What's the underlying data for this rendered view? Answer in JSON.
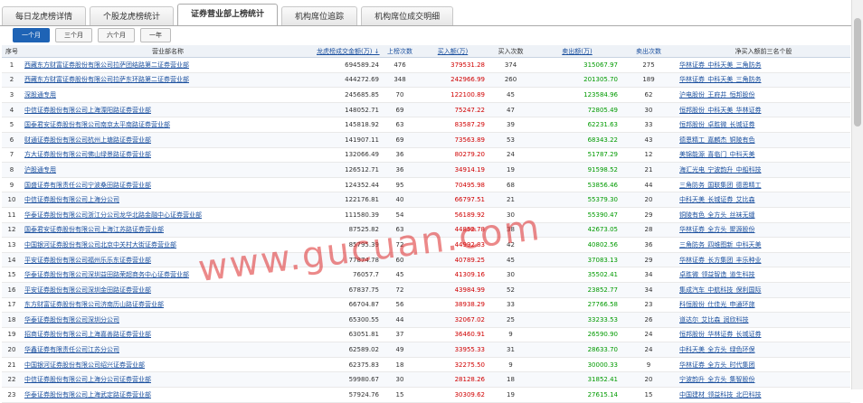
{
  "tabs": [
    {
      "label": "每日龙虎榜详情",
      "active": false
    },
    {
      "label": "个股龙虎榜统计",
      "active": false
    },
    {
      "label": "证券营业部上榜统计",
      "active": true
    },
    {
      "label": "机构席位追踪",
      "active": false
    },
    {
      "label": "机构席位成交明细",
      "active": false
    }
  ],
  "periods": [
    {
      "label": "一个月",
      "active": true
    },
    {
      "label": "三个月",
      "active": false
    },
    {
      "label": "六个月",
      "active": false
    },
    {
      "label": "一年",
      "active": false
    }
  ],
  "table": {
    "headers": [
      "序号",
      "营业部名称",
      "龙虎榜成交金额(万) ↓",
      "上榜次数",
      "买入额(万)",
      "买入次数",
      "卖出额(万)",
      "卖出次数",
      "净买入额前三名个股"
    ],
    "rows": [
      [
        "1",
        "西藏东方财富证券股份有限公司拉萨团结路第二证券营业部",
        "694589.24",
        "476",
        "379531.28",
        "374",
        "315067.97",
        "275",
        "华林证券 中科天美 三角防务"
      ],
      [
        "2",
        "西藏东方财富证券股份有限公司拉萨东环路第二证券营业部",
        "444272.69",
        "348",
        "242966.99",
        "260",
        "201305.70",
        "189",
        "华林证券 中科天美 三角防务"
      ],
      [
        "3",
        "深股通专用",
        "245685.85",
        "70",
        "122100.89",
        "45",
        "123584.96",
        "62",
        "沪电股份 王府井 恒邦股份"
      ],
      [
        "4",
        "中信证券股份有限公司上海溧阳路证券营业部",
        "148052.71",
        "69",
        "75247.22",
        "47",
        "72805.49",
        "30",
        "恒邦股份 中科天美 华林证券"
      ],
      [
        "5",
        "国泰君安证券股份有限公司南京太平南路证券营业部",
        "145818.92",
        "63",
        "83587.29",
        "39",
        "62231.63",
        "33",
        "恒邦股份 卓胜微 长城证券"
      ],
      [
        "6",
        "财通证券股份有限公司杭州上塘路证券营业部",
        "141907.11",
        "69",
        "73563.89",
        "53",
        "68343.22",
        "43",
        "德恩精工 嘉麟杰 铜陵有色"
      ],
      [
        "7",
        "方大证券股份有限公司佛山绿景路证券营业部",
        "132066.49",
        "36",
        "80279.20",
        "24",
        "51787.29",
        "12",
        "美锦能源 喜临门 中科天美"
      ],
      [
        "8",
        "沪股通专用",
        "126512.71",
        "36",
        "34914.19",
        "19",
        "91598.52",
        "21",
        "海汇光电 宁波韵升 中船科技"
      ],
      [
        "9",
        "国盛证券有限责任公司宁波桑田路证券营业部",
        "124352.44",
        "95",
        "70495.98",
        "68",
        "53856.46",
        "44",
        "三角防务 国联集团 德恩精工"
      ],
      [
        "10",
        "中信证券股份有限公司上海分公司",
        "122176.81",
        "40",
        "66797.51",
        "21",
        "55379.30",
        "20",
        "中科天美 长城证券 艾比森"
      ],
      [
        "11",
        "华泰证券股份有限公司浙江分公司龙华北路金融中心证券营业部",
        "111580.39",
        "54",
        "56189.92",
        "30",
        "55390.47",
        "29",
        "铜陵有色 全方头 丝袜无缝"
      ],
      [
        "12",
        "国泰君安证券股份有限公司上海江苏路证券营业部",
        "87525.82",
        "63",
        "44852.78",
        "38",
        "42673.05",
        "28",
        "华林证券 全方头 聚源股份"
      ],
      [
        "13",
        "中国银河证券股份有限公司北京中关村大街证券营业部",
        "85795.39",
        "72",
        "44992.83",
        "42",
        "40802.56",
        "36",
        "三角防务 四维图新 中科天美"
      ],
      [
        "14",
        "平安证券股份有限公司福州乐乐东证券营业部",
        "77874.78",
        "60",
        "40789.25",
        "45",
        "37083.13",
        "29",
        "华林证券 长方集团 丰乐种业"
      ],
      [
        "15",
        "华泰证券股份有限公司深圳益田路荣超商务中心证券营业部",
        "76057.7",
        "45",
        "41309.16",
        "30",
        "35502.41",
        "34",
        "卓胜微 领益智造 道生科技"
      ],
      [
        "16",
        "平安证券股份有限公司深圳金田路证券营业部",
        "67837.75",
        "72",
        "43984.99",
        "52",
        "23852.77",
        "34",
        "集成汽车 中航科技 保利国际"
      ],
      [
        "17",
        "东方财富证券股份有限公司济南历山路证券营业部",
        "66704.87",
        "56",
        "38938.29",
        "33",
        "27766.58",
        "23",
        "科恒股份 仕佳光 申通环旅"
      ],
      [
        "18",
        "华泰证券股份有限公司深圳分公司",
        "65300.55",
        "44",
        "32067.02",
        "25",
        "33233.53",
        "26",
        "道达尔 艾比森 润欣科技"
      ],
      [
        "19",
        "招商证券股份有限公司上海嘉善路证券营业部",
        "63051.81",
        "37",
        "36460.91",
        "9",
        "26590.90",
        "24",
        "恒邦股份 华林证券 长城证券"
      ],
      [
        "20",
        "华鑫证券有限责任公司江苏分公司",
        "62589.02",
        "49",
        "33955.33",
        "31",
        "28633.70",
        "24",
        "中科天美 全方头 绿色环保"
      ],
      [
        "21",
        "中国银河证券股份有限公司绍兴证券营业部",
        "62375.83",
        "18",
        "32275.50",
        "9",
        "30000.33",
        "9",
        "华林证券 全方头 时代集团"
      ],
      [
        "22",
        "中信证券股份有限公司上海分公司证券营业部",
        "59980.67",
        "30",
        "28128.26",
        "18",
        "31852.41",
        "20",
        "宁波韵升 全方头 集智股份"
      ],
      [
        "23",
        "华泰证券股份有限公司上海武定路证券营业部",
        "57924.76",
        "15",
        "30309.62",
        "19",
        "27615.14",
        "15",
        "中国建材 领益科技 北巴科技"
      ]
    ]
  },
  "watermark": "www.gucuan.com",
  "colors": {
    "buy": "#d00000",
    "sell": "#009a00",
    "link": "#1a4f9e",
    "active_period": "#1e63b5"
  }
}
